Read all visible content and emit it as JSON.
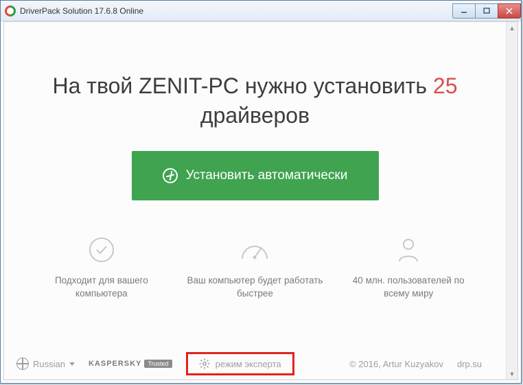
{
  "window": {
    "title": "DriverPack Solution 17.6.8 Online"
  },
  "headline": {
    "prefix": "На твой ZENIT-PC нужно установить ",
    "count": "25",
    "suffix": " драйверов"
  },
  "install_button": {
    "label": "Установить автоматически"
  },
  "features": [
    {
      "icon": "check",
      "text": "Подходит для вашего компьютера"
    },
    {
      "icon": "gauge",
      "text": "Ваш компьютер будет работать быстрее"
    },
    {
      "icon": "user",
      "text": "40 млн. пользователей по всему миру"
    }
  ],
  "footer": {
    "language": "Russian",
    "kaspersky": "KASPERSKY",
    "trusted": "Trusted",
    "expert_mode": "режим эксперта",
    "copyright": "© 2016, Artur Kuzyakov",
    "site": "drp.su"
  }
}
